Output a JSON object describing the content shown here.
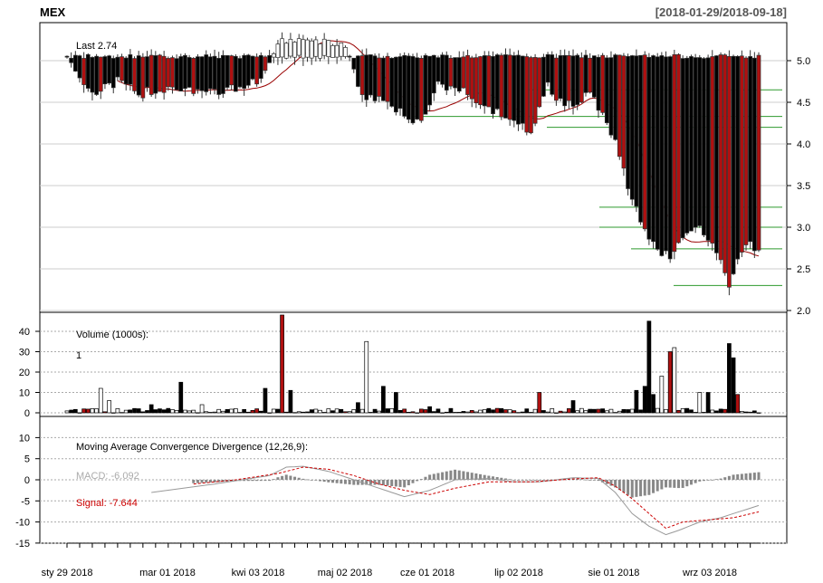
{
  "header": {
    "symbol": "MEX",
    "date_range": "[2018-01-29/2018-09-18]"
  },
  "colors": {
    "up": "#ffffff",
    "down": "#000000",
    "down_red": "#b01010",
    "sma": "#990000",
    "support": "#2e9a2e",
    "macd_hist": "#888888",
    "signal": "#cc0000"
  },
  "price_panel": {
    "last_label": "Last 2.74",
    "y_ticks": [
      "2.0",
      "2.5",
      "3.0",
      "3.5",
      "4.0",
      "4.5",
      "5.0"
    ],
    "horizontal_lines": [
      4.65,
      4.33,
      4.2,
      3.24,
      3.0,
      2.74,
      2.3
    ]
  },
  "volume_panel": {
    "label": "Volume (1000s):",
    "value": "1",
    "y_ticks": [
      "0",
      "10",
      "20",
      "30",
      "40"
    ]
  },
  "macd_panel": {
    "label": "Moving Average Convergence Divergence (12,26,9):",
    "macd_label": "MACD: -6.092",
    "signal_label": "Signal: -7.644",
    "y_ticks": [
      "-15",
      "-10",
      "-5",
      "0",
      "5",
      "10"
    ]
  },
  "x_axis": {
    "labels": [
      "sty 29 2018",
      "mar 01 2018",
      "kwi 03 2018",
      "maj 02 2018",
      "cze 01 2018",
      "lip 02 2018",
      "sie 01 2018",
      "wrz 03 2018"
    ]
  },
  "chart_data": {
    "type": "candlestick",
    "title": "MEX",
    "date_range": "2018-01-29/2018-09-18",
    "price_ylim": [
      2.0,
      5.3
    ],
    "volume_ylim": [
      0,
      48
    ],
    "macd_ylim": [
      -15,
      12
    ],
    "macd_last": -6.092,
    "signal_last": -7.644,
    "close_keypoints": [
      [
        0,
        5.05
      ],
      [
        6,
        4.6
      ],
      [
        12,
        4.75
      ],
      [
        17,
        4.6
      ],
      [
        25,
        4.7
      ],
      [
        36,
        4.6
      ],
      [
        45,
        4.75
      ],
      [
        50,
        5.2
      ],
      [
        55,
        5.25
      ],
      [
        62,
        5.2
      ],
      [
        66,
        5.2
      ],
      [
        70,
        4.6
      ],
      [
        75,
        4.55
      ],
      [
        80,
        4.35
      ],
      [
        84,
        4.25
      ],
      [
        88,
        4.7
      ],
      [
        95,
        4.65
      ],
      [
        100,
        4.4
      ],
      [
        106,
        4.3
      ],
      [
        110,
        4.15
      ],
      [
        114,
        4.7
      ],
      [
        118,
        4.45
      ],
      [
        124,
        4.6
      ],
      [
        128,
        4.3
      ],
      [
        131,
        3.9
      ],
      [
        134,
        3.3
      ],
      [
        137,
        3.0
      ],
      [
        140,
        2.7
      ],
      [
        143,
        2.65
      ],
      [
        147,
        2.9
      ],
      [
        150,
        3.05
      ],
      [
        153,
        2.75
      ],
      [
        156,
        2.5
      ],
      [
        157,
        2.3
      ],
      [
        160,
        2.75
      ],
      [
        162,
        2.8
      ],
      [
        164,
        2.74
      ]
    ],
    "volume_spikes": [
      [
        8,
        12
      ],
      [
        10,
        6
      ],
      [
        20,
        4
      ],
      [
        27,
        15
      ],
      [
        32,
        4
      ],
      [
        47,
        12
      ],
      [
        51,
        48
      ],
      [
        53,
        11
      ],
      [
        69,
        5
      ],
      [
        71,
        35
      ],
      [
        75,
        13
      ],
      [
        78,
        10
      ],
      [
        86,
        3
      ],
      [
        112,
        10
      ],
      [
        120,
        6
      ],
      [
        135,
        11
      ],
      [
        137,
        13
      ],
      [
        138,
        45
      ],
      [
        139,
        9
      ],
      [
        141,
        18
      ],
      [
        143,
        30
      ],
      [
        144,
        32
      ],
      [
        150,
        10
      ],
      [
        152,
        10
      ],
      [
        157,
        34
      ],
      [
        158,
        27
      ],
      [
        159,
        9
      ]
    ],
    "macd_keypoints": [
      [
        20,
        -3
      ],
      [
        35,
        -1
      ],
      [
        48,
        1
      ],
      [
        52,
        3
      ],
      [
        56,
        3.2
      ],
      [
        62,
        2
      ],
      [
        68,
        0
      ],
      [
        74,
        -2
      ],
      [
        80,
        -4
      ],
      [
        86,
        -2.5
      ],
      [
        92,
        0
      ],
      [
        100,
        0.3
      ],
      [
        106,
        -0.5
      ],
      [
        112,
        -0.5
      ],
      [
        120,
        0.5
      ],
      [
        126,
        0.3
      ],
      [
        130,
        -3
      ],
      [
        134,
        -8
      ],
      [
        138,
        -11
      ],
      [
        142,
        -13
      ],
      [
        145,
        -12
      ],
      [
        150,
        -10
      ],
      [
        155,
        -9
      ],
      [
        158,
        -8
      ],
      [
        164,
        -6.1
      ]
    ],
    "signal_keypoints": [
      [
        30,
        -1
      ],
      [
        40,
        0
      ],
      [
        50,
        1.5
      ],
      [
        56,
        3
      ],
      [
        62,
        2.5
      ],
      [
        68,
        1
      ],
      [
        74,
        -1
      ],
      [
        80,
        -2.5
      ],
      [
        86,
        -3.5
      ],
      [
        92,
        -2
      ],
      [
        100,
        -0.5
      ],
      [
        110,
        -0.5
      ],
      [
        120,
        0.2
      ],
      [
        126,
        0.5
      ],
      [
        130,
        -1.5
      ],
      [
        134,
        -4.5
      ],
      [
        138,
        -8
      ],
      [
        142,
        -11.5
      ],
      [
        146,
        -10
      ],
      [
        152,
        -9.5
      ],
      [
        158,
        -9
      ],
      [
        164,
        -7.6
      ]
    ]
  }
}
